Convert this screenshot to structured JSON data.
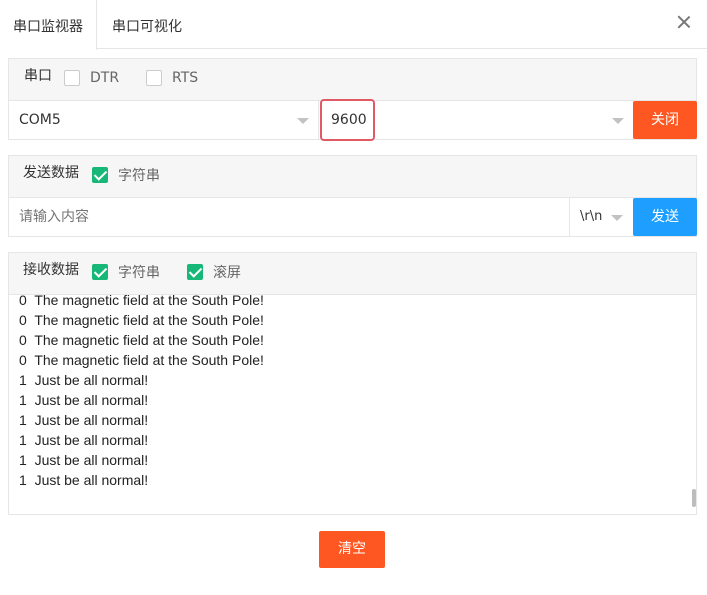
{
  "tabs": [
    {
      "label": "串口监视器",
      "active": true
    },
    {
      "label": "串口可视化",
      "active": false
    }
  ],
  "serial": {
    "title": "串口",
    "dtr": {
      "label": "DTR",
      "checked": false
    },
    "rts": {
      "label": "RTS",
      "checked": false
    },
    "port": "COM5",
    "baud": "9600",
    "close_button": "关闭"
  },
  "send": {
    "title": "发送数据",
    "string_mode": {
      "label": "字符串",
      "checked": true
    },
    "placeholder": "请输入内容",
    "line_ending": "\\r\\n",
    "send_button": "发送"
  },
  "receive": {
    "title": "接收数据",
    "string_mode": {
      "label": "字符串",
      "checked": true
    },
    "autoscroll": {
      "label": "滚屏",
      "checked": true
    },
    "lines": [
      "0  The magnetic field at the South Pole!",
      "0  The magnetic field at the South Pole!",
      "0  The magnetic field at the South Pole!",
      "0  The magnetic field at the South Pole!",
      "1  Just be all normal!",
      "1  Just be all normal!",
      "1  Just be all normal!",
      "1  Just be all normal!",
      "1  Just be all normal!",
      "1  Just be all normal!"
    ],
    "clear_button": "清空"
  },
  "colors": {
    "accent_orange": "#ff5722",
    "accent_blue": "#1e9fff",
    "check_green": "#16b777",
    "highlight_red": "#e05a66"
  }
}
